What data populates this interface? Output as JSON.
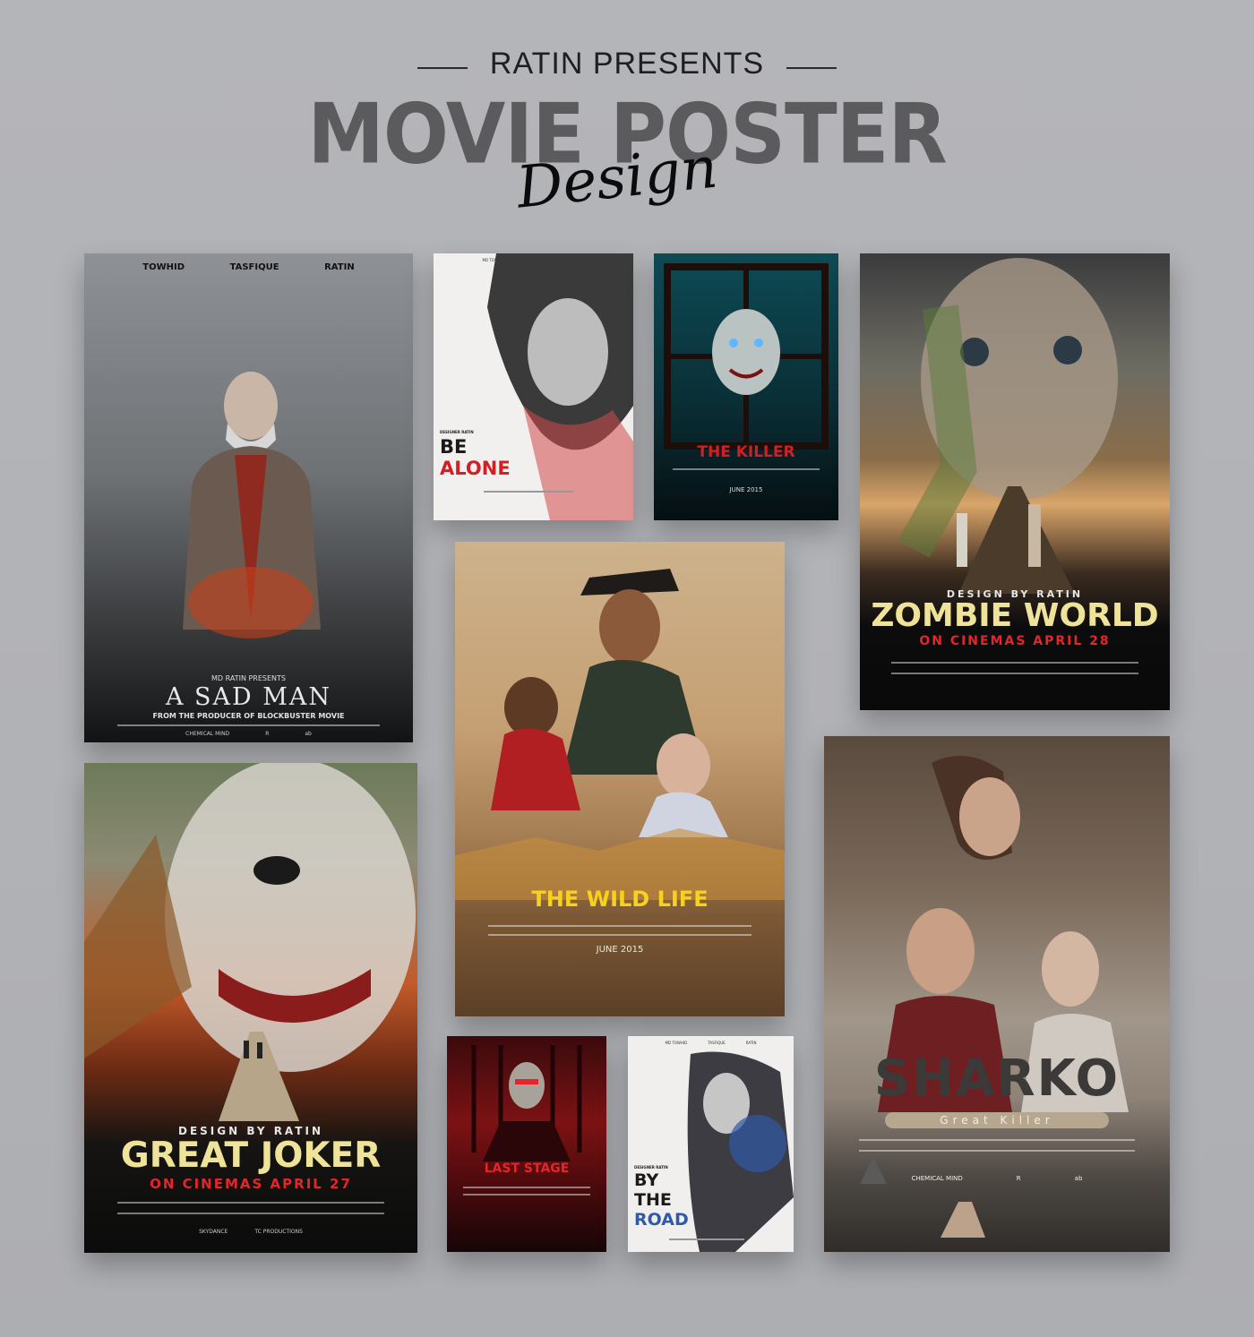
{
  "header": {
    "presents": "RATIN PRESENTS",
    "title_main": "MOVIE POSTER",
    "title_script": "Design"
  },
  "posters": {
    "sad_man": {
      "credits": [
        "TOWHID",
        "TASFIQUE",
        "RATIN"
      ],
      "presenter": "MD RATIN PRESENTS",
      "title": "A SAD MAN",
      "tagline": "FROM THE PRODUCER OF BLOCKBUSTER MOVIE",
      "logos": [
        "CHEMICAL MIND",
        "R",
        "ab"
      ]
    },
    "be_alone": {
      "credits": [
        "MD TOWHID",
        "TASFIQUE",
        "RATIN"
      ],
      "designer": "DESIGNER RATIN",
      "title_line1": "BE",
      "title_line2": "ALONE"
    },
    "killer": {
      "title": "THE KILLER",
      "date": "JUNE 2015"
    },
    "zombie": {
      "designer": "DESIGN BY RATIN",
      "title": "ZOMBIE WORLD",
      "release": "ON CINEMAS APRIL 28"
    },
    "wild_life": {
      "title": "THE WILD LIFE",
      "date": "JUNE 2015"
    },
    "joker": {
      "designer": "DESIGN BY RATIN",
      "title": "GREAT JOKER",
      "release": "ON CINEMAS APRIL 27",
      "logos": [
        "SKYDANCE",
        "TC PRODUCTIONS"
      ]
    },
    "last_stage": {
      "title": "LAST STAGE"
    },
    "by_road": {
      "credits": [
        "MD TOWHID",
        "TASFIQUE",
        "RATIN"
      ],
      "designer": "DESIGNER RATIN",
      "title_line1": "BY",
      "title_line2": "THE",
      "title_line3": "ROAD"
    },
    "sharko": {
      "title": "SHARKO",
      "subtitle": "Great Killer",
      "logos": [
        "CHEMICAL MIND",
        "R",
        "ab"
      ]
    }
  },
  "colors": {
    "background": "#b2b3b7",
    "headline_gray": "#5b5b5e",
    "killer_red": "#d11f24",
    "zombie_yellow": "#efe39a",
    "wild_yellow": "#f5d21b",
    "joker_red": "#e3262b",
    "road_blue": "#2f5aa6"
  }
}
